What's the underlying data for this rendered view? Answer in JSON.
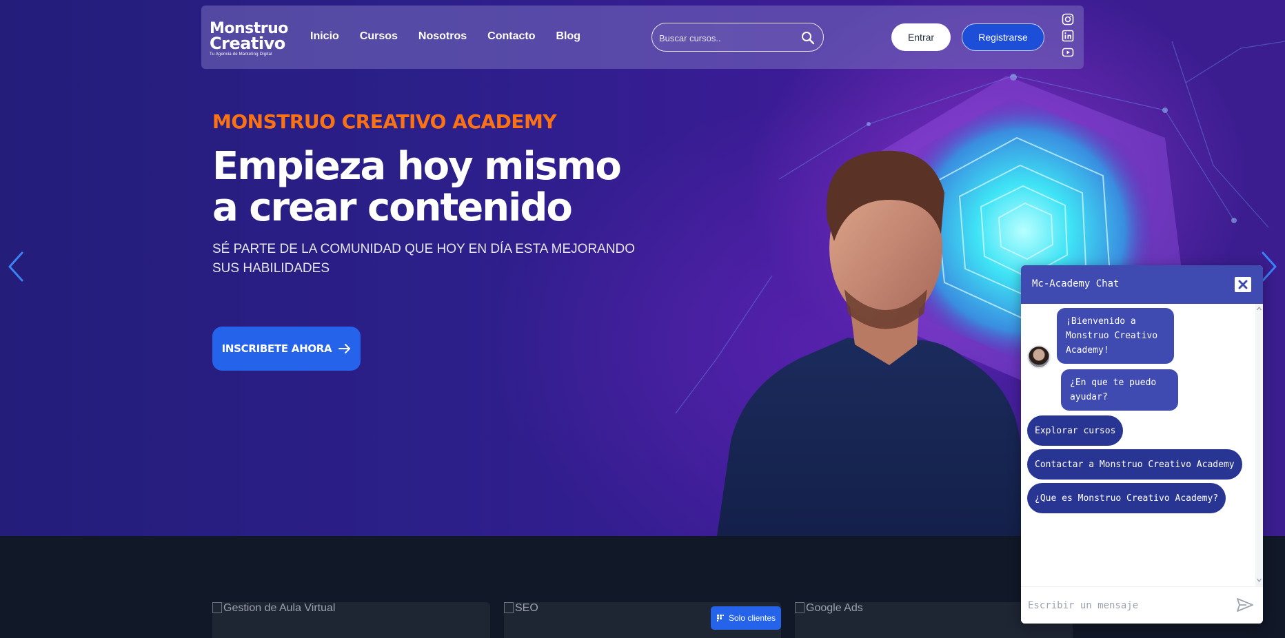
{
  "nav": {
    "logo_line1": "Monstruo",
    "logo_line2": "Creativo",
    "logo_tagline": "Tu Agencia de Marketing Digital",
    "links": [
      {
        "label": "Inicio"
      },
      {
        "label": "Cursos"
      },
      {
        "label": "Nosotros"
      },
      {
        "label": "Contacto"
      },
      {
        "label": "Blog"
      }
    ],
    "search_placeholder": "Buscar cursos..",
    "login_label": "Entrar",
    "register_label": "Registrarse",
    "social_icons": [
      "instagram-icon",
      "linkedin-icon",
      "youtube-icon"
    ]
  },
  "hero": {
    "kicker": "MONSTRUO CREATIVO ACADEMY",
    "heading": "Empieza hoy mismo a crear contenido",
    "subheading": "SÉ PARTE DE LA COMUNIDAD QUE HOY EN DÍA ESTA MEJORANDO SUS HABILIDADES",
    "cta_label": "INSCRIBETE AHORA"
  },
  "courses": {
    "cards": [
      {
        "alt": "Gestion de Aula Virtual"
      },
      {
        "alt": "SEO"
      },
      {
        "alt": "Google Ads"
      }
    ],
    "badge": "Solo clientes"
  },
  "chat": {
    "title": "Mc-Academy Chat",
    "messages": [
      "¡Bienvenido a Monstruo Creativo Academy!",
      "¿En que te puedo ayudar?"
    ],
    "options": [
      "Explorar cursos",
      "Contactar a Monstruo Creativo Academy",
      "¿Que es Monstruo Creativo Academy?"
    ],
    "input_placeholder": "Escribir un mensaje"
  },
  "colors": {
    "accent_orange": "#f97316",
    "primary_blue": "#2563eb",
    "chat_header": "#3f4bb0",
    "chat_option": "#283593",
    "dark_bg": "#111827"
  }
}
